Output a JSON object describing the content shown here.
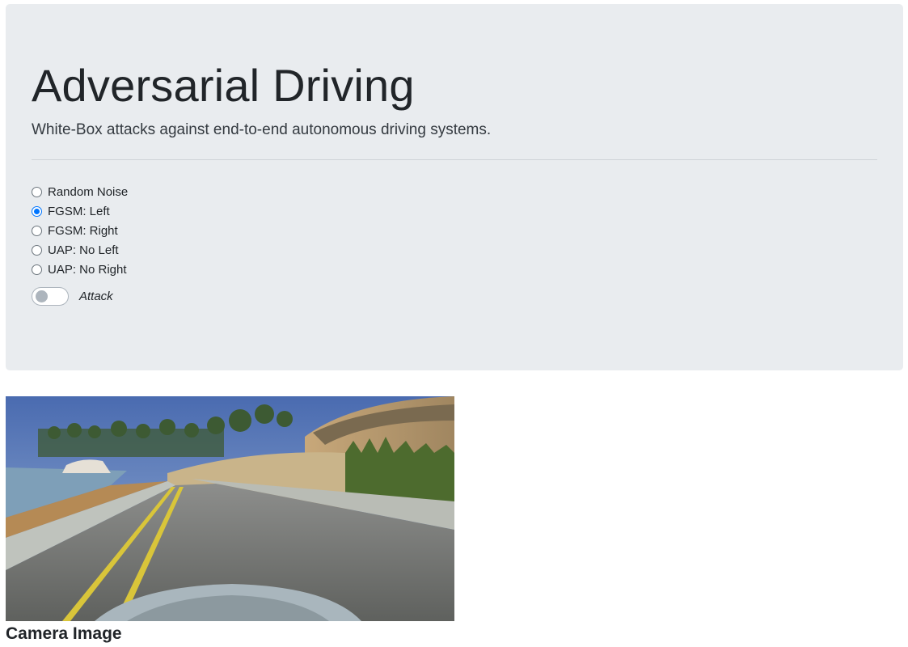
{
  "header": {
    "title": "Adversarial Driving",
    "subtitle": "White-Box attacks against end-to-end autonomous driving systems."
  },
  "attack_options": [
    {
      "label": "Random Noise",
      "checked": false
    },
    {
      "label": "FGSM: Left",
      "checked": true
    },
    {
      "label": "FGSM: Right",
      "checked": false
    },
    {
      "label": "UAP: No Left",
      "checked": false
    },
    {
      "label": "UAP: No Right",
      "checked": false
    }
  ],
  "attack_toggle": {
    "label": "Attack",
    "on": false
  },
  "camera": {
    "caption": "Camera Image"
  },
  "colors": {
    "jumbotron_bg": "#e9ecef",
    "radio_accent": "#0075ff"
  }
}
